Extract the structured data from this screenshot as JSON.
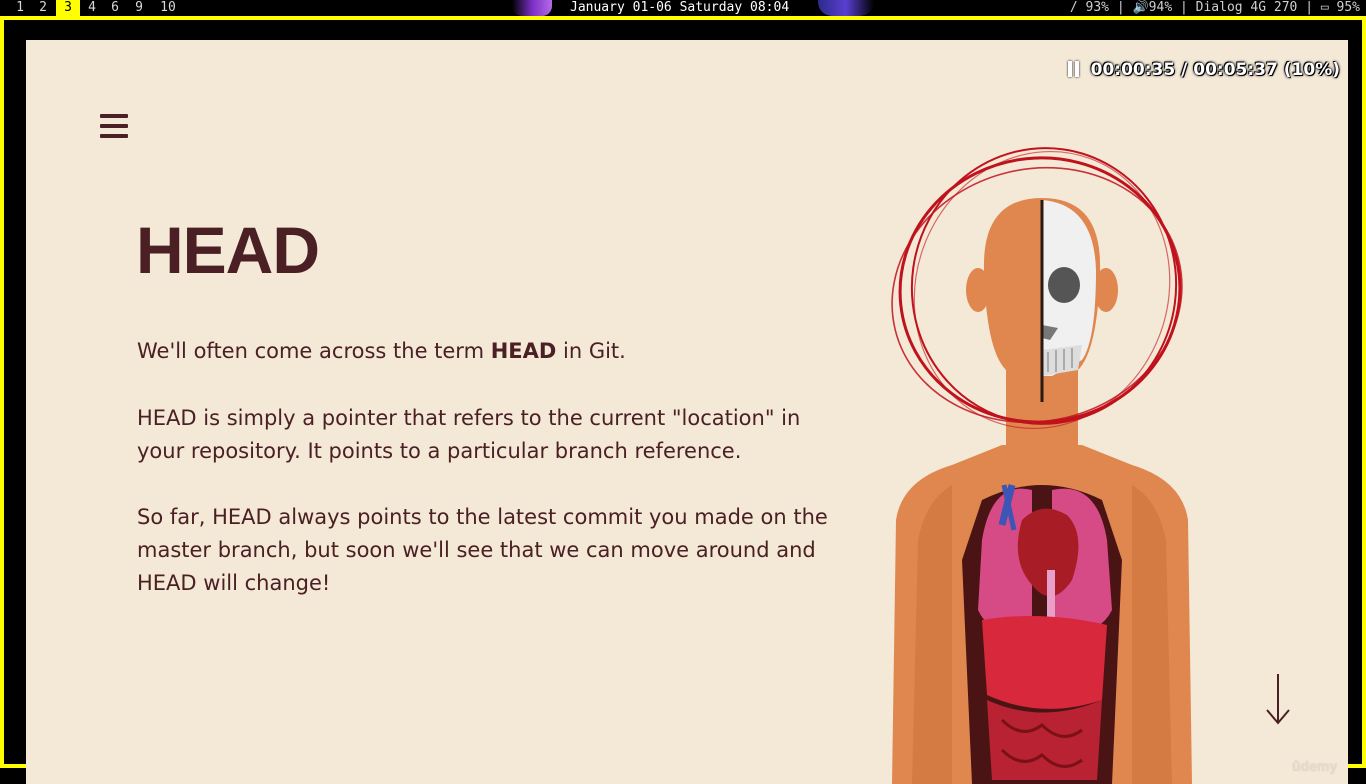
{
  "topbar": {
    "workspaces": [
      {
        "label": "1",
        "active": false
      },
      {
        "label": "2",
        "active": false
      },
      {
        "label": "3",
        "active": true
      },
      {
        "label": "4",
        "active": false
      },
      {
        "label": "6",
        "active": false
      },
      {
        "label": "9",
        "active": false
      },
      {
        "label": "10",
        "active": false
      }
    ],
    "datetime": "January 01-06 Saturday 08:04",
    "status": "/ 93% | 🔊94% |  Dialog 4G 270 | ▭ 95%"
  },
  "player": {
    "elapsed": "00:00:35",
    "separator": "/",
    "total": "00:05:37",
    "percent": "(10%)"
  },
  "slide": {
    "title": "HEAD",
    "p1": {
      "before": "We'll often come across the term ",
      "bold": "HEAD",
      "after": " in Git."
    },
    "p2": "HEAD is simply a pointer that refers to the current \"location\" in your repository.   It points to a particular branch reference.",
    "p3": "So far, HEAD always points to the latest commit you made on the master branch, but soon we'll see that we can move around and HEAD will change!",
    "watermark": "ûdemy"
  },
  "colors": {
    "frame": "#ffff00",
    "slide_bg": "#f4e8d7",
    "text": "#4a2024",
    "circle": "#c0121c",
    "skin": "#e0874f"
  },
  "icons": {
    "menu": "hamburger-menu-icon",
    "pause": "pause-icon",
    "scroll": "arrow-down-icon"
  }
}
